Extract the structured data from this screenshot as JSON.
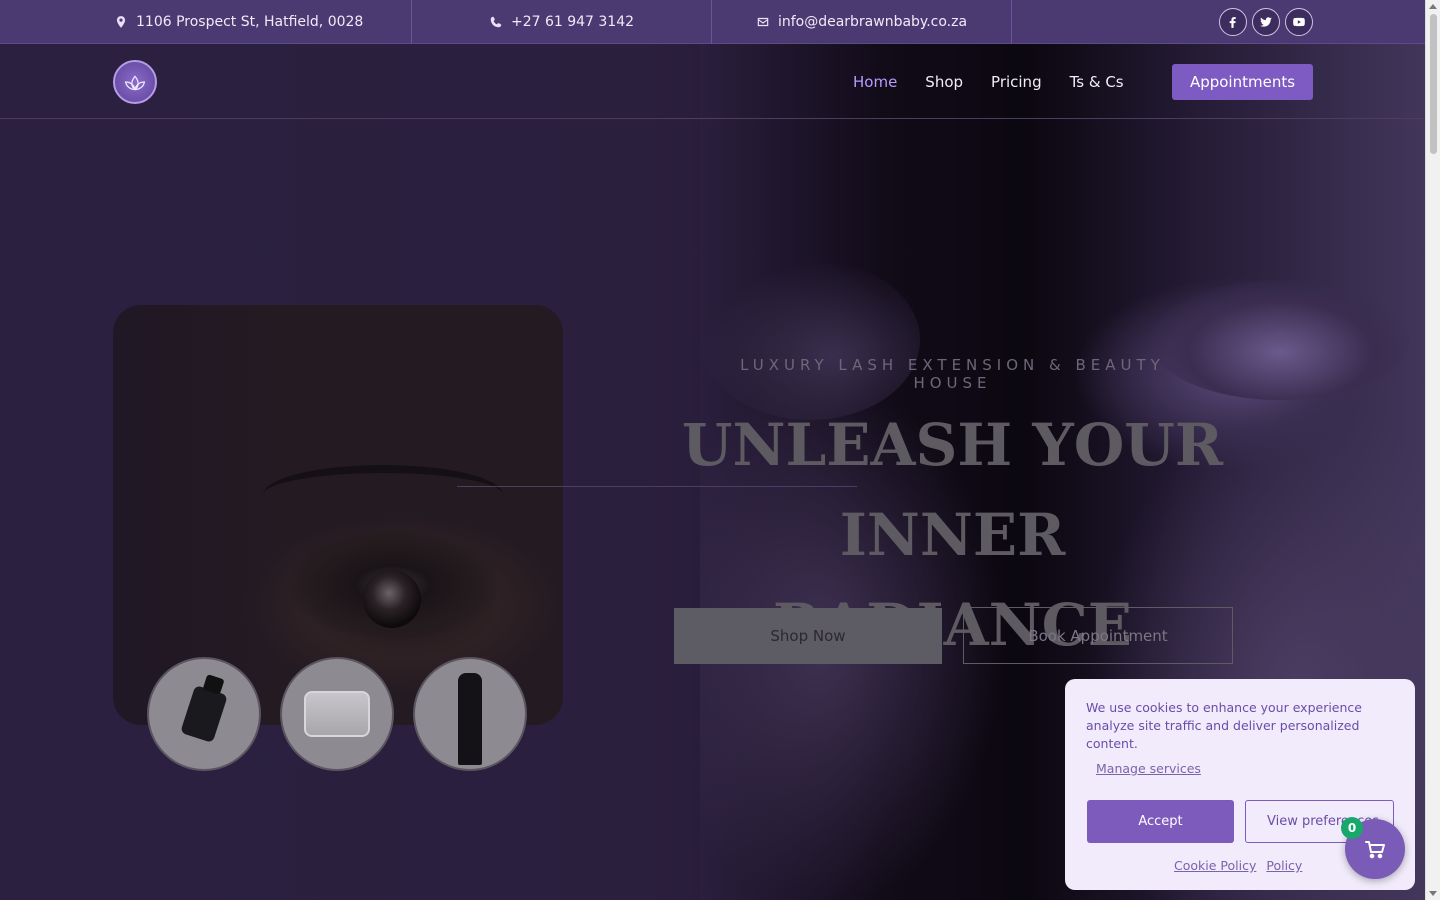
{
  "topbar": {
    "address": "1106 Prospect St, Hatfield, 0028",
    "phone": "+27 61 947 3142",
    "email": "info@dearbrawnbaby.co.za",
    "social": [
      "facebook-icon",
      "twitter-icon",
      "youtube-icon"
    ]
  },
  "nav": {
    "items": [
      {
        "label": "Home",
        "active": true
      },
      {
        "label": "Shop"
      },
      {
        "label": "Pricing"
      },
      {
        "label": "Ts & Cs"
      }
    ],
    "cta": "Appointments"
  },
  "hero": {
    "eyebrow": "LUXURY LASH EXTENSION & BEAUTY HOUSE",
    "headline_line1": "UNLEASH YOUR",
    "headline_line2": "INNER RADIANCE",
    "shop_button": "Shop Now",
    "book_button": "Book Appointment"
  },
  "cookie": {
    "message": "We use cookies to enhance your experience analyze site traffic and deliver personalized content.",
    "manage": "Manage services",
    "accept": "Accept",
    "preferences": "View preferences",
    "cookie_policy": "Cookie Policy",
    "policy": "Policy"
  },
  "cart": {
    "count": "0"
  },
  "colors": {
    "accent": "#7e5bc2",
    "topbar": "#4b3a72",
    "badge": "#18a86b"
  }
}
